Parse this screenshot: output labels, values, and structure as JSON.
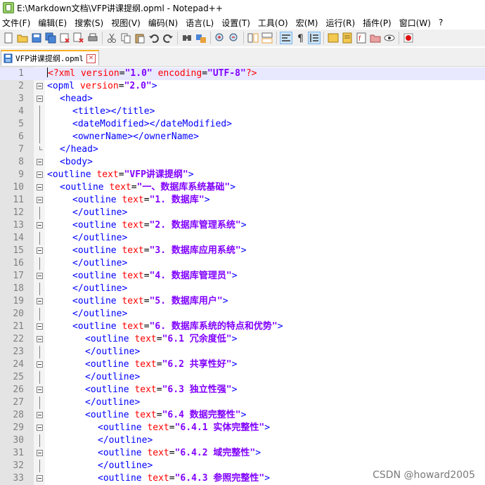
{
  "window": {
    "title": "E:\\Markdown文档\\VFP讲课提纲.opml - Notepad++"
  },
  "menu": [
    "文件(F)",
    "编辑(E)",
    "搜索(S)",
    "视图(V)",
    "编码(N)",
    "语言(L)",
    "设置(T)",
    "工具(O)",
    "宏(M)",
    "运行(R)",
    "插件(P)",
    "窗口(W)",
    "?"
  ],
  "toolbar": {
    "icons": [
      "new-file-icon",
      "open-file-icon",
      "save-icon",
      "save-all-icon",
      "close-icon",
      "close-all-icon",
      "print-icon",
      "cut-icon",
      "copy-icon",
      "paste-icon",
      "undo-icon",
      "redo-icon",
      "find-icon",
      "replace-icon",
      "zoom-in-icon",
      "zoom-out-icon",
      "sync-v-icon",
      "sync-h-icon",
      "word-wrap-icon",
      "show-all-chars-icon",
      "indent-guide-icon",
      "user-lang-icon",
      "doc-map-icon",
      "function-list-icon",
      "folder-workspace-icon",
      "monitor-icon",
      "record-macro-icon"
    ]
  },
  "tab": {
    "label": "VFP讲课提纲.opml"
  },
  "editor": {
    "lines": [
      {
        "n": "1",
        "indent": 0,
        "parts": [
          [
            "pi",
            "<?xml "
          ],
          [
            "attr",
            "version"
          ],
          [
            "eq",
            "="
          ],
          [
            "val",
            "\"1.0\""
          ],
          [
            "eq",
            " "
          ],
          [
            "attr",
            "encoding"
          ],
          [
            "eq",
            "="
          ],
          [
            "val",
            "\"UTF-8\""
          ],
          [
            "pi",
            "?>"
          ]
        ]
      },
      {
        "n": "2",
        "indent": 0,
        "parts": [
          [
            "tag",
            "<opml "
          ],
          [
            "attr",
            "version"
          ],
          [
            "eq",
            "="
          ],
          [
            "val",
            "\"2.0\""
          ],
          [
            "tag",
            ">"
          ]
        ]
      },
      {
        "n": "3",
        "indent": 1,
        "parts": [
          [
            "tag",
            "<head>"
          ]
        ]
      },
      {
        "n": "4",
        "indent": 2,
        "parts": [
          [
            "tag",
            "<title></title>"
          ]
        ]
      },
      {
        "n": "5",
        "indent": 2,
        "parts": [
          [
            "tag",
            "<dateModified></dateModified>"
          ]
        ]
      },
      {
        "n": "6",
        "indent": 2,
        "parts": [
          [
            "tag",
            "<ownerName></ownerName>"
          ]
        ]
      },
      {
        "n": "7",
        "indent": 1,
        "parts": [
          [
            "tag",
            "</head>"
          ]
        ]
      },
      {
        "n": "8",
        "indent": 1,
        "parts": [
          [
            "tag",
            "<body>"
          ]
        ]
      },
      {
        "n": "9",
        "indent": 0,
        "parts": [
          [
            "tag",
            "<outline "
          ],
          [
            "attr",
            "text"
          ],
          [
            "eq",
            "="
          ],
          [
            "val",
            "\"VFP讲课提纲\""
          ],
          [
            "tag",
            ">"
          ]
        ]
      },
      {
        "n": "10",
        "indent": 1,
        "parts": [
          [
            "tag",
            "<outline "
          ],
          [
            "attr",
            "text"
          ],
          [
            "eq",
            "="
          ],
          [
            "val",
            "\"一、数据库系统基础\""
          ],
          [
            "tag",
            ">"
          ]
        ]
      },
      {
        "n": "11",
        "indent": 2,
        "parts": [
          [
            "tag",
            "<outline "
          ],
          [
            "attr",
            "text"
          ],
          [
            "eq",
            "="
          ],
          [
            "val",
            "\"1. 数据库\""
          ],
          [
            "tag",
            ">"
          ]
        ]
      },
      {
        "n": "12",
        "indent": 2,
        "parts": [
          [
            "tag",
            "</outline>"
          ]
        ]
      },
      {
        "n": "13",
        "indent": 2,
        "parts": [
          [
            "tag",
            "<outline "
          ],
          [
            "attr",
            "text"
          ],
          [
            "eq",
            "="
          ],
          [
            "val",
            "\"2. 数据库管理系统\""
          ],
          [
            "tag",
            ">"
          ]
        ]
      },
      {
        "n": "14",
        "indent": 2,
        "parts": [
          [
            "tag",
            "</outline>"
          ]
        ]
      },
      {
        "n": "15",
        "indent": 2,
        "parts": [
          [
            "tag",
            "<outline "
          ],
          [
            "attr",
            "text"
          ],
          [
            "eq",
            "="
          ],
          [
            "val",
            "\"3. 数据库应用系统\""
          ],
          [
            "tag",
            ">"
          ]
        ]
      },
      {
        "n": "16",
        "indent": 2,
        "parts": [
          [
            "tag",
            "</outline>"
          ]
        ]
      },
      {
        "n": "17",
        "indent": 2,
        "parts": [
          [
            "tag",
            "<outline "
          ],
          [
            "attr",
            "text"
          ],
          [
            "eq",
            "="
          ],
          [
            "val",
            "\"4. 数据库管理员\""
          ],
          [
            "tag",
            ">"
          ]
        ]
      },
      {
        "n": "18",
        "indent": 2,
        "parts": [
          [
            "tag",
            "</outline>"
          ]
        ]
      },
      {
        "n": "19",
        "indent": 2,
        "parts": [
          [
            "tag",
            "<outline "
          ],
          [
            "attr",
            "text"
          ],
          [
            "eq",
            "="
          ],
          [
            "val",
            "\"5. 数据库用户\""
          ],
          [
            "tag",
            ">"
          ]
        ]
      },
      {
        "n": "20",
        "indent": 2,
        "parts": [
          [
            "tag",
            "</outline>"
          ]
        ]
      },
      {
        "n": "21",
        "indent": 2,
        "parts": [
          [
            "tag",
            "<outline "
          ],
          [
            "attr",
            "text"
          ],
          [
            "eq",
            "="
          ],
          [
            "val",
            "\"6. 数据库系统的特点和优势\""
          ],
          [
            "tag",
            ">"
          ]
        ]
      },
      {
        "n": "22",
        "indent": 3,
        "parts": [
          [
            "tag",
            "<outline "
          ],
          [
            "attr",
            "text"
          ],
          [
            "eq",
            "="
          ],
          [
            "val",
            "\"6.1 冗余度低\""
          ],
          [
            "tag",
            ">"
          ]
        ]
      },
      {
        "n": "23",
        "indent": 3,
        "parts": [
          [
            "tag",
            "</outline>"
          ]
        ]
      },
      {
        "n": "24",
        "indent": 3,
        "parts": [
          [
            "tag",
            "<outline "
          ],
          [
            "attr",
            "text"
          ],
          [
            "eq",
            "="
          ],
          [
            "val",
            "\"6.2 共享性好\""
          ],
          [
            "tag",
            ">"
          ]
        ]
      },
      {
        "n": "25",
        "indent": 3,
        "parts": [
          [
            "tag",
            "</outline>"
          ]
        ]
      },
      {
        "n": "26",
        "indent": 3,
        "parts": [
          [
            "tag",
            "<outline "
          ],
          [
            "attr",
            "text"
          ],
          [
            "eq",
            "="
          ],
          [
            "val",
            "\"6.3 独立性强\""
          ],
          [
            "tag",
            ">"
          ]
        ]
      },
      {
        "n": "27",
        "indent": 3,
        "parts": [
          [
            "tag",
            "</outline>"
          ]
        ]
      },
      {
        "n": "28",
        "indent": 3,
        "parts": [
          [
            "tag",
            "<outline "
          ],
          [
            "attr",
            "text"
          ],
          [
            "eq",
            "="
          ],
          [
            "val",
            "\"6.4 数据完整性\""
          ],
          [
            "tag",
            ">"
          ]
        ]
      },
      {
        "n": "29",
        "indent": 4,
        "parts": [
          [
            "tag",
            "<outline "
          ],
          [
            "attr",
            "text"
          ],
          [
            "eq",
            "="
          ],
          [
            "val",
            "\"6.4.1 实体完整性\""
          ],
          [
            "tag",
            ">"
          ]
        ]
      },
      {
        "n": "30",
        "indent": 4,
        "parts": [
          [
            "tag",
            "</outline>"
          ]
        ]
      },
      {
        "n": "31",
        "indent": 4,
        "parts": [
          [
            "tag",
            "<outline "
          ],
          [
            "attr",
            "text"
          ],
          [
            "eq",
            "="
          ],
          [
            "val",
            "\"6.4.2 域完整性\""
          ],
          [
            "tag",
            ">"
          ]
        ]
      },
      {
        "n": "32",
        "indent": 4,
        "parts": [
          [
            "tag",
            "</outline>"
          ]
        ]
      },
      {
        "n": "33",
        "indent": 4,
        "parts": [
          [
            "tag",
            "<outline "
          ],
          [
            "attr",
            "text"
          ],
          [
            "eq",
            "="
          ],
          [
            "val",
            "\"6.4.3 参照完整性\""
          ],
          [
            "tag",
            ">"
          ]
        ]
      }
    ],
    "folds": {
      "2": "box",
      "3": "box",
      "7": "end",
      "8": "box",
      "9": "box",
      "10": "box",
      "11": "box",
      "13": "box",
      "15": "box",
      "17": "box",
      "19": "box",
      "21": "box",
      "22": "box",
      "24": "box",
      "26": "box",
      "28": "box",
      "29": "box",
      "31": "box",
      "33": "box"
    }
  },
  "watermark": "CSDN @howard2005"
}
